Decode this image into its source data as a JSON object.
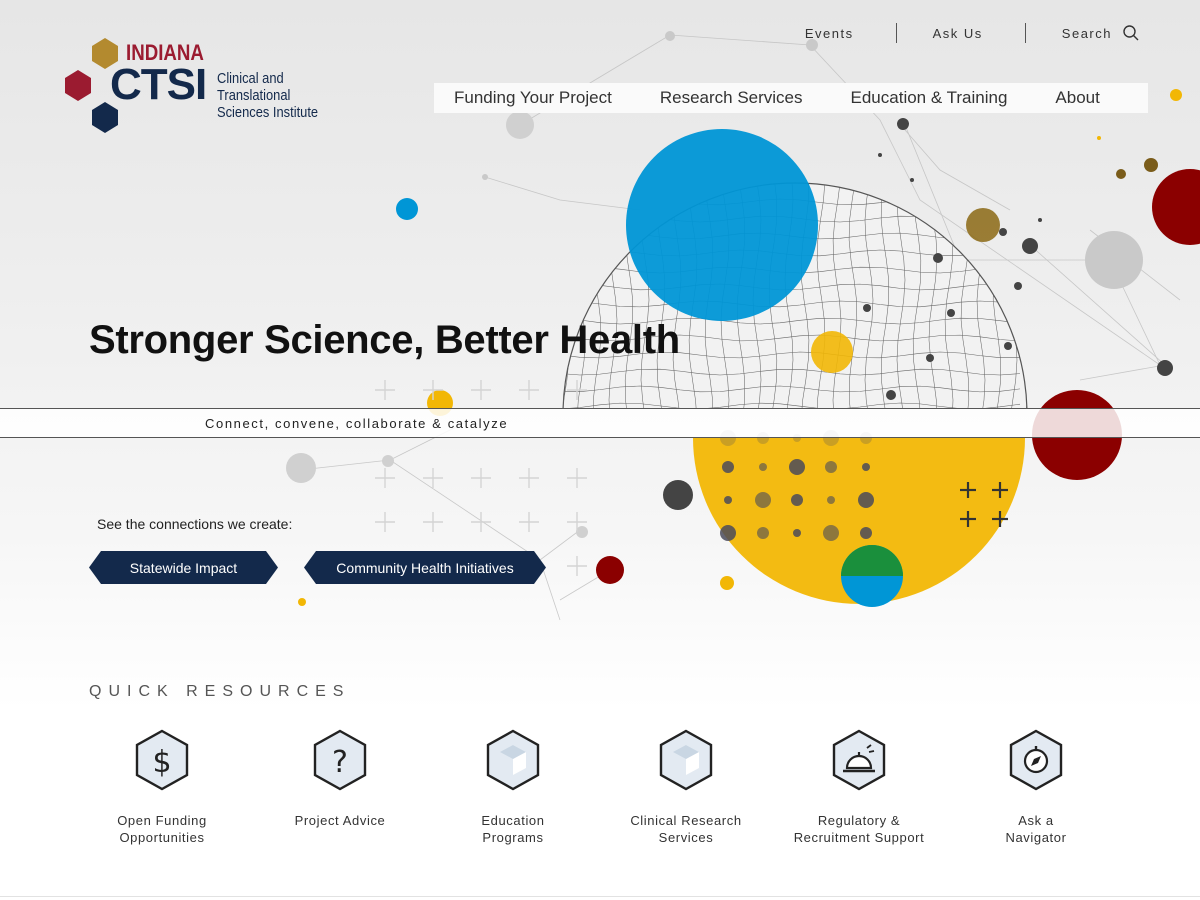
{
  "logo": {
    "indiana": "INDIANA",
    "ctsi": "CTSI",
    "subtitle_line1": "Clinical and Translational",
    "subtitle_line2": "Sciences Institute",
    "colors": {
      "gold": "#b38a2f",
      "red": "#9b1b30",
      "navy": "#13294b"
    }
  },
  "utility_nav": {
    "events": "Events",
    "ask_us": "Ask Us",
    "search": "Search"
  },
  "main_nav": {
    "items": [
      "Funding Your Project",
      "Research Services",
      "Education & Training",
      "About"
    ]
  },
  "hero": {
    "headline": "Stronger Science, Better Health",
    "tagline": "Connect, convene, collaborate & catalyze",
    "connections_label": "See the connections we create:",
    "buttons": [
      "Statewide Impact",
      "Community Health Initiatives"
    ]
  },
  "quick_resources": {
    "title": "QUICK RESOURCES",
    "items": [
      {
        "label": "Open Funding\nOpportunities",
        "icon": "dollar-icon"
      },
      {
        "label": "Project Advice",
        "icon": "question-icon"
      },
      {
        "label": "Education\nPrograms",
        "icon": "cube-icon"
      },
      {
        "label": "Clinical Research\nServices",
        "icon": "cube-icon"
      },
      {
        "label": "Regulatory &\nRecruitment Support",
        "icon": "bell-icon"
      },
      {
        "label": "Ask a\nNavigator",
        "icon": "compass-icon"
      }
    ]
  },
  "colors": {
    "navy": "#13294b",
    "blue": "#0096d6",
    "yellow": "#f2b705",
    "crimson": "#8b0000",
    "green": "#1a8f3c"
  }
}
